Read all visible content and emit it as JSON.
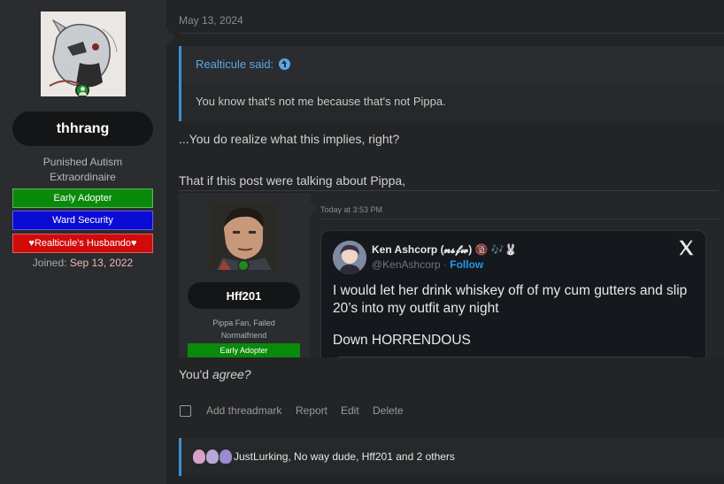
{
  "user": {
    "username": "thhrang",
    "title_line1": "Punished Autism",
    "title_line2": "Extraordinaire",
    "banners": [
      "Early Adopter",
      "Ward Security",
      "♥Realticule's Husbando♥"
    ],
    "joined_label": "Joined:",
    "joined_value": "Sep 13, 2022"
  },
  "post": {
    "date": "May 13, 2024",
    "quote": {
      "author": "Realticule said:",
      "text": "You know that's not me because that's not Pippa."
    },
    "line1": "...You do realize what this implies, right?",
    "line2": "That if this post were talking about Pippa,",
    "line3_prefix": "You'd ",
    "line3_em": "agree?"
  },
  "embedded": {
    "username": "Hff201",
    "title_line1": "Pippa Fan, Failed",
    "title_line2": "Normalfriend",
    "banner": "Early Adopter",
    "date": "Today at 3:53 PM",
    "tweet": {
      "display_name": "Ken Ashcorp (𝓷𝓼𝓯𝔀) 🔞 🎶🐰",
      "handle": "@KenAshcorp",
      "follow": "Follow",
      "text": "I would let her drink whiskey off of my cum gutters and slip 20’s into my outfit any night",
      "text2": "Down HORRENDOUS"
    }
  },
  "actions": {
    "add_threadmark": "Add threadmark",
    "report": "Report",
    "edit": "Edit",
    "delete": "Delete"
  },
  "reactions": {
    "text": "JustLurking, No way dude, Hff201 and 2 others",
    "icon_colors": [
      "#d9a0c8",
      "#b9a6d8",
      "#9b8cd0"
    ]
  },
  "colors": {
    "accent": "#3d8fd6",
    "quote_author": "#5aa7e6",
    "online": "#1f8b1f",
    "banner_green": "#0a8a0a",
    "banner_blue": "#0b0bd6",
    "banner_red": "#d10a0a",
    "tweet_follow": "#1d9bf0"
  }
}
